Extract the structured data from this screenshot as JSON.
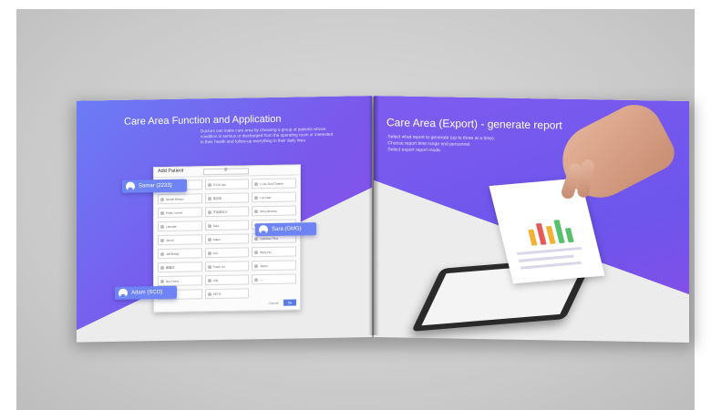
{
  "left_page": {
    "title": "Care Area Function and Application",
    "description": "Doctors can make care area by choosing a group of patients whose condition is serious or discharged from the operating room or interested in their health and follow-up everything in their daily lives",
    "dialog": {
      "title": "Add Patient",
      "search_placeholder": "",
      "patients": [
        "Richard Hu",
        "Yi-Fei Lee",
        "Li-Ke Dorri Tanner",
        "Daniel Nelson",
        "苗志佑",
        "Lim Hart",
        "Peter Lorenz",
        "王馬修拉沙",
        "Rina Otnomu",
        "Lamutte",
        "Sara",
        "Richard",
        "Jacob",
        "Adam",
        "Callahan Fina",
        "Jeff Brady",
        "Lee",
        "Mary Hu",
        "蔡嘉宗",
        "Frank Lin",
        "Adam",
        "Nyx Hung",
        "Lilly",
        "—",
        "NORVIN",
        "SETH"
      ],
      "cancel_label": "Cancel",
      "ok_label": "Ok"
    },
    "chips": [
      {
        "label": "Samar (2233)"
      },
      {
        "label": "Sara (GMG)"
      },
      {
        "label": "Adam (SCO)"
      }
    ]
  },
  "right_page": {
    "title": "Care Area (Export) - generate report",
    "steps": [
      ".Select what report to generate (up to three at a time).",
      ".Choose report time range and personnel.",
      ".Select export report mode."
    ]
  },
  "colors": {
    "accent_purple": "#7a58ec",
    "chip_blue": "#6f84f4",
    "ok_button": "#5a7be6"
  }
}
